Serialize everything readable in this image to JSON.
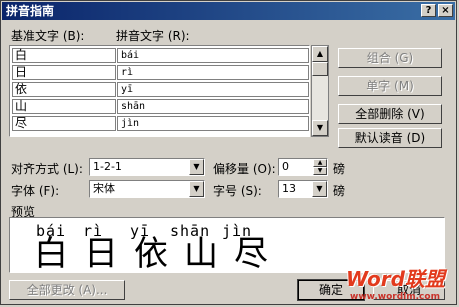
{
  "window": {
    "title": "拼音指南",
    "help_glyph": "?",
    "close_glyph": "×"
  },
  "headers": {
    "base_text": "基准文字 (B):",
    "pinyin_text": "拼音文字 (R):"
  },
  "rows": [
    {
      "base": "白",
      "pinyin": "bái"
    },
    {
      "base": "日",
      "pinyin": "rì"
    },
    {
      "base": "依",
      "pinyin": "yī"
    },
    {
      "base": "山",
      "pinyin": "shān"
    },
    {
      "base": "尽",
      "pinyin": "jìn"
    }
  ],
  "scrollbar": {
    "up": "▲",
    "down": "▼"
  },
  "side_buttons": {
    "combine": "组合 (G)",
    "single": "单字 (M)",
    "delete_all": "全部删除 (V)",
    "default_reading": "默认读音 (D)"
  },
  "format": {
    "align_label": "对齐方式 (L):",
    "align_value": "1-2-1",
    "offset_label": "偏移量 (O):",
    "offset_value": "0",
    "offset_unit": "磅",
    "font_label": "字体 (F):",
    "font_value": "宋体",
    "size_label": "字号 (S):",
    "size_value": "13",
    "size_unit": "磅",
    "arrow": "▼"
  },
  "preview": {
    "label": "预览",
    "pinyin": [
      "bái",
      "rì",
      "yī",
      "shān",
      "jìn"
    ],
    "chars": [
      "白",
      "日",
      "依",
      "山",
      "尽"
    ]
  },
  "bottom_buttons": {
    "change_all": "全部更改 (A)...",
    "ok": "确定",
    "cancel": "取消"
  },
  "watermark": {
    "text": "Word联盟",
    "url": "www.wordlm.com"
  }
}
